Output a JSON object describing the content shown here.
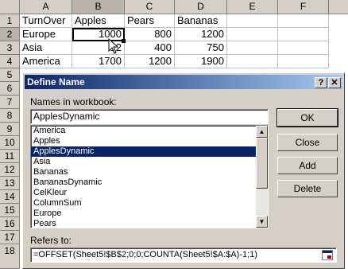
{
  "sheet": {
    "columns": [
      "A",
      "B",
      "C",
      "D",
      "E",
      "F"
    ],
    "rows": [
      "1",
      "2",
      "3",
      "4",
      "5",
      "6",
      "7",
      "8",
      "9",
      "10",
      "11",
      "12",
      "13",
      "14",
      "15",
      "16",
      "17",
      "18"
    ],
    "cells": {
      "A1": "TurnOver",
      "B1": "Apples",
      "C1": "Pears",
      "D1": "Bananas",
      "A2": "Europe",
      "B2": "1000",
      "C2": "800",
      "D2": "1200",
      "A3": "Asia",
      "B3": "12",
      "C3": "400",
      "D3": "750",
      "A4": "America",
      "B4": "1700",
      "C4": "1200",
      "D4": "1900"
    }
  },
  "dialog": {
    "title": "Define Name",
    "help_btn": "?",
    "close_btn": "✕",
    "names_label": "Names in workbook:",
    "name_value": "ApplesDynamic",
    "names": [
      "America",
      "Apples",
      "ApplesDynamic",
      "Asia",
      "Bananas",
      "BananasDynamic",
      "CelKleur",
      "ColumnSum",
      "Europe",
      "Pears"
    ],
    "selected_index": 2,
    "refers_label": "Refers to:",
    "refers_value": "=OFFSET(Sheet5!$B$2;0;0;COUNTA(Sheet5!$A:$A)-1;1)",
    "buttons": {
      "ok": "OK",
      "close": "Close",
      "add": "Add",
      "delete": "Delete"
    }
  }
}
